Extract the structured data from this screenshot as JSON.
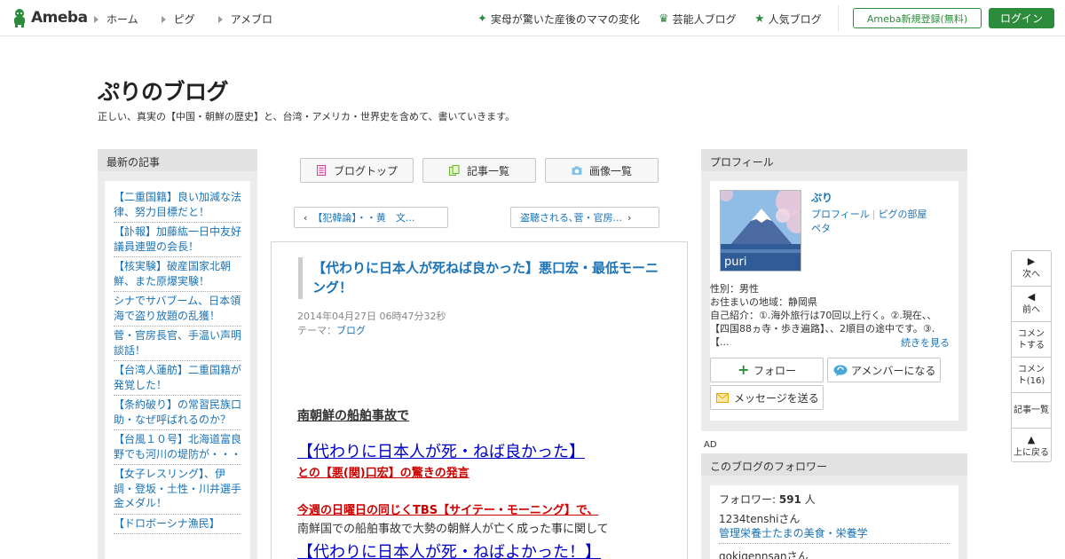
{
  "header": {
    "logo_text": "Ameba",
    "nav": [
      "ホーム",
      "ピグ",
      "アメブロ"
    ],
    "trends": [
      {
        "icon": "sparkle-icon",
        "label": "実母が驚いた産後のママの変化"
      },
      {
        "icon": "crown-icon",
        "label": "芸能人ブログ"
      },
      {
        "icon": "star-icon",
        "label": "人気ブログ"
      }
    ],
    "register_label": "Ameba新規登録(無料)",
    "login_label": "ログイン"
  },
  "blog": {
    "title": "ぷりのブログ",
    "description": "正しい、真実の【中国・朝鮮の歴史】と、台湾・アメリカ・世界史を含めて、書いていきます。"
  },
  "left": {
    "heading": "最新の記事",
    "entries": [
      "【二重国籍】良い加減な法律、努力目標だと！",
      "【訃報】加藤紘一日中友好議員連盟の会長！",
      "【核実験】破産国家北朝鮮、また原爆実験！",
      "シナでサバブーム、日本領海で盗り放題の乱獲！",
      "菅・官房長官、手温い声明談話！",
      "【台湾人蓮舫】二重国籍が発覚した！",
      "【条約破り】の常習民族口助・なぜ呼ばれるのか？",
      "【台風１０号】北海道富良野でも河川の堤防が・・・",
      "【女子レスリング】、伊調・登坂・土性・川井選手金メダル！",
      "【ドロボーシナ漁民】"
    ]
  },
  "center": {
    "tabs": [
      "ブログトップ",
      "記事一覧",
      "画像一覧"
    ],
    "prev_label": "【犯韓論】・・黄　文...",
    "next_label": "盗聴される､菅・官房...",
    "article": {
      "title": "【代わりに日本人が死ねば良かった】悪口宏・最低モーニング！",
      "date": "2014年04月27日 06時47分32秒",
      "theme_label": "テーマ：",
      "theme": "ブログ",
      "body": [
        "南朝鮮の船舶事故で",
        "【代わりに日本人が死・ねば良かった】",
        "との【悪(関)口宏】の驚きの発言",
        "今週の日曜日の同じくTBS【サイテー・モーニング】で、",
        "南鮮国での船舶事故で大勢の朝鮮人が亡く成った事に関して",
        "【代わりに日本人が死・ねばよかった！】"
      ]
    }
  },
  "profile": {
    "heading": "プロフィール",
    "image_caption": "puri",
    "name": "ぷり",
    "link_profile": "プロフィール",
    "link_room": "ピグの部屋",
    "link_peta": "ペタ",
    "gender": "性別：男性",
    "region": "お住まいの地域：静岡県",
    "intro": "自己紹介：①.海外旅行は70回以上行く。②.現在、、【四国88ヵ寺・歩き遍路】、、2順目の途中です。③.【...",
    "more": "続きを見る",
    "follow": "フォロー",
    "amember": "アメンバーになる",
    "message": "メッセージを送る"
  },
  "ad_label": "AD",
  "followers": {
    "heading": "このブログのフォロワー",
    "count_label": "フォロワー: ",
    "count": "591",
    "count_unit": " 人",
    "list": [
      {
        "user": "1234tenshiさん",
        "blog": "管理栄養士たまの美食・栄養学"
      },
      {
        "user": "gokigennsanさん",
        "blog": ""
      }
    ]
  },
  "floatnav": [
    "次へ",
    "前へ",
    "コメントする",
    "コメント(16)",
    "記事一覧",
    "上に戻る"
  ]
}
